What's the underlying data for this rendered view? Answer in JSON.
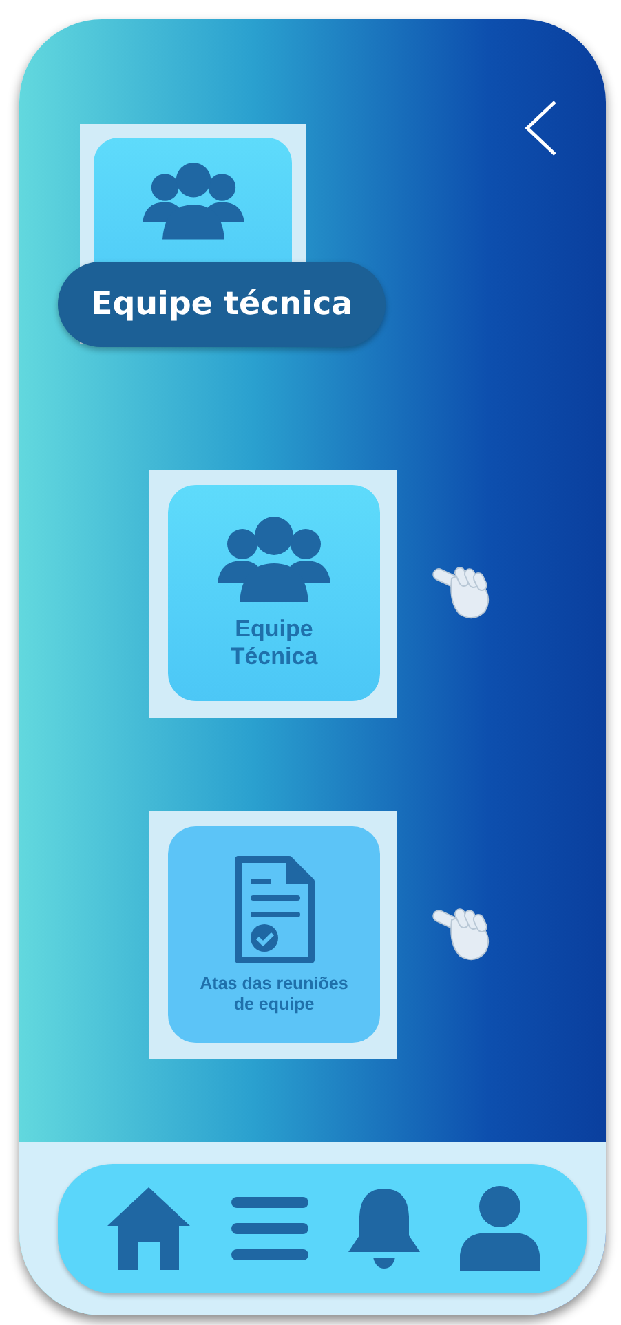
{
  "header": {
    "tile": {
      "kind": "team"
    },
    "title": "Equipe técnica"
  },
  "menu": [
    {
      "kind": "team",
      "label": "Equipe\nTécnica"
    },
    {
      "kind": "document",
      "label": "Atas das reuniões\nde equipe"
    }
  ],
  "nav": [
    {
      "kind": "home"
    },
    {
      "kind": "menu"
    },
    {
      "kind": "bell"
    },
    {
      "kind": "user"
    }
  ]
}
